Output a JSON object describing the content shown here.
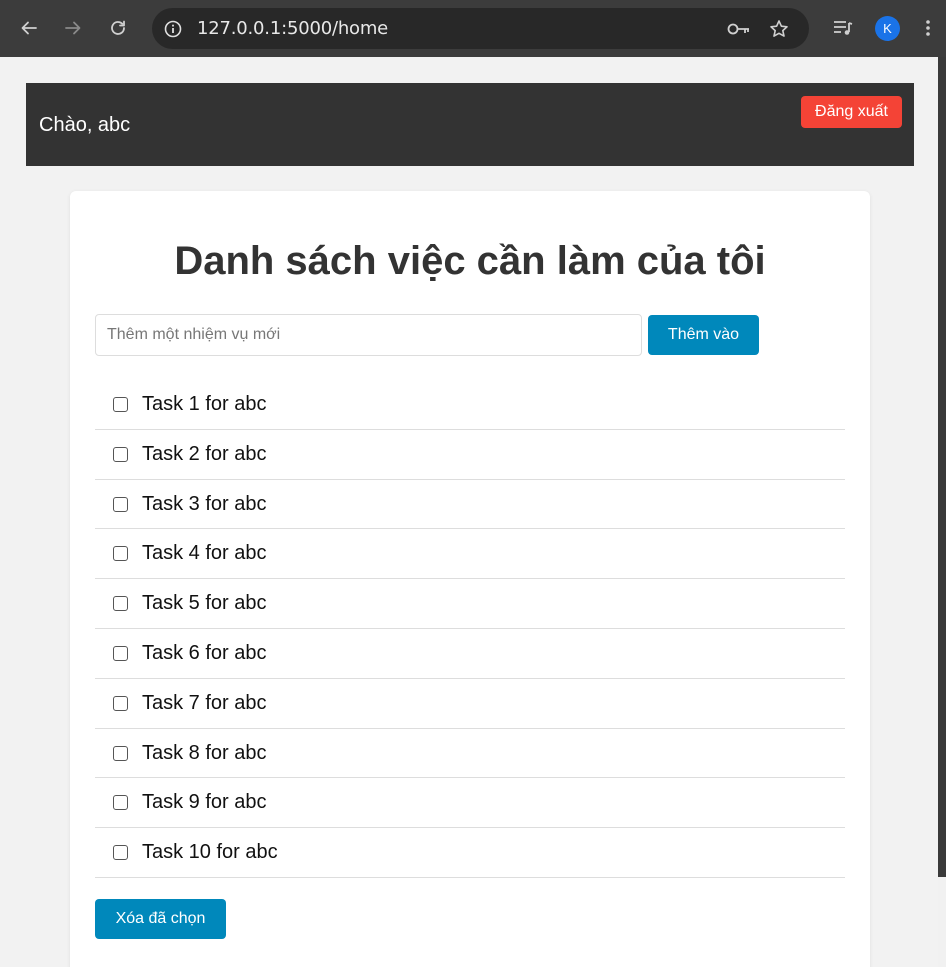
{
  "browser": {
    "url": "127.0.0.1:5000/home",
    "profile_initial": "K",
    "icons": {
      "back": "back-arrow-icon",
      "forward": "forward-arrow-icon",
      "reload": "reload-icon",
      "info": "info-icon",
      "password": "key-icon",
      "bookmark": "star-icon",
      "media": "playlist-icon",
      "menu": "kebab-menu-icon"
    }
  },
  "header": {
    "greeting": "Chào, abc",
    "logout_label": "Đăng xuất"
  },
  "main": {
    "title": "Danh sách việc cần làm của tôi",
    "input_placeholder": "Thêm một nhiệm vụ mới",
    "input_value": "",
    "add_label": "Thêm vào",
    "tasks": [
      {
        "label": "Task 1 for abc",
        "checked": false
      },
      {
        "label": "Task 2 for abc",
        "checked": false
      },
      {
        "label": "Task 3 for abc",
        "checked": false
      },
      {
        "label": "Task 4 for abc",
        "checked": false
      },
      {
        "label": "Task 5 for abc",
        "checked": false
      },
      {
        "label": "Task 6 for abc",
        "checked": false
      },
      {
        "label": "Task 7 for abc",
        "checked": false
      },
      {
        "label": "Task 8 for abc",
        "checked": false
      },
      {
        "label": "Task 9 for abc",
        "checked": false
      },
      {
        "label": "Task 10 for abc",
        "checked": false
      }
    ],
    "delete_label": "Xóa đã chọn"
  },
  "colors": {
    "header_bg": "#333333",
    "logout_bg": "#f44336",
    "primary_button": "#0088bb",
    "page_bg": "#f2f2f2"
  }
}
